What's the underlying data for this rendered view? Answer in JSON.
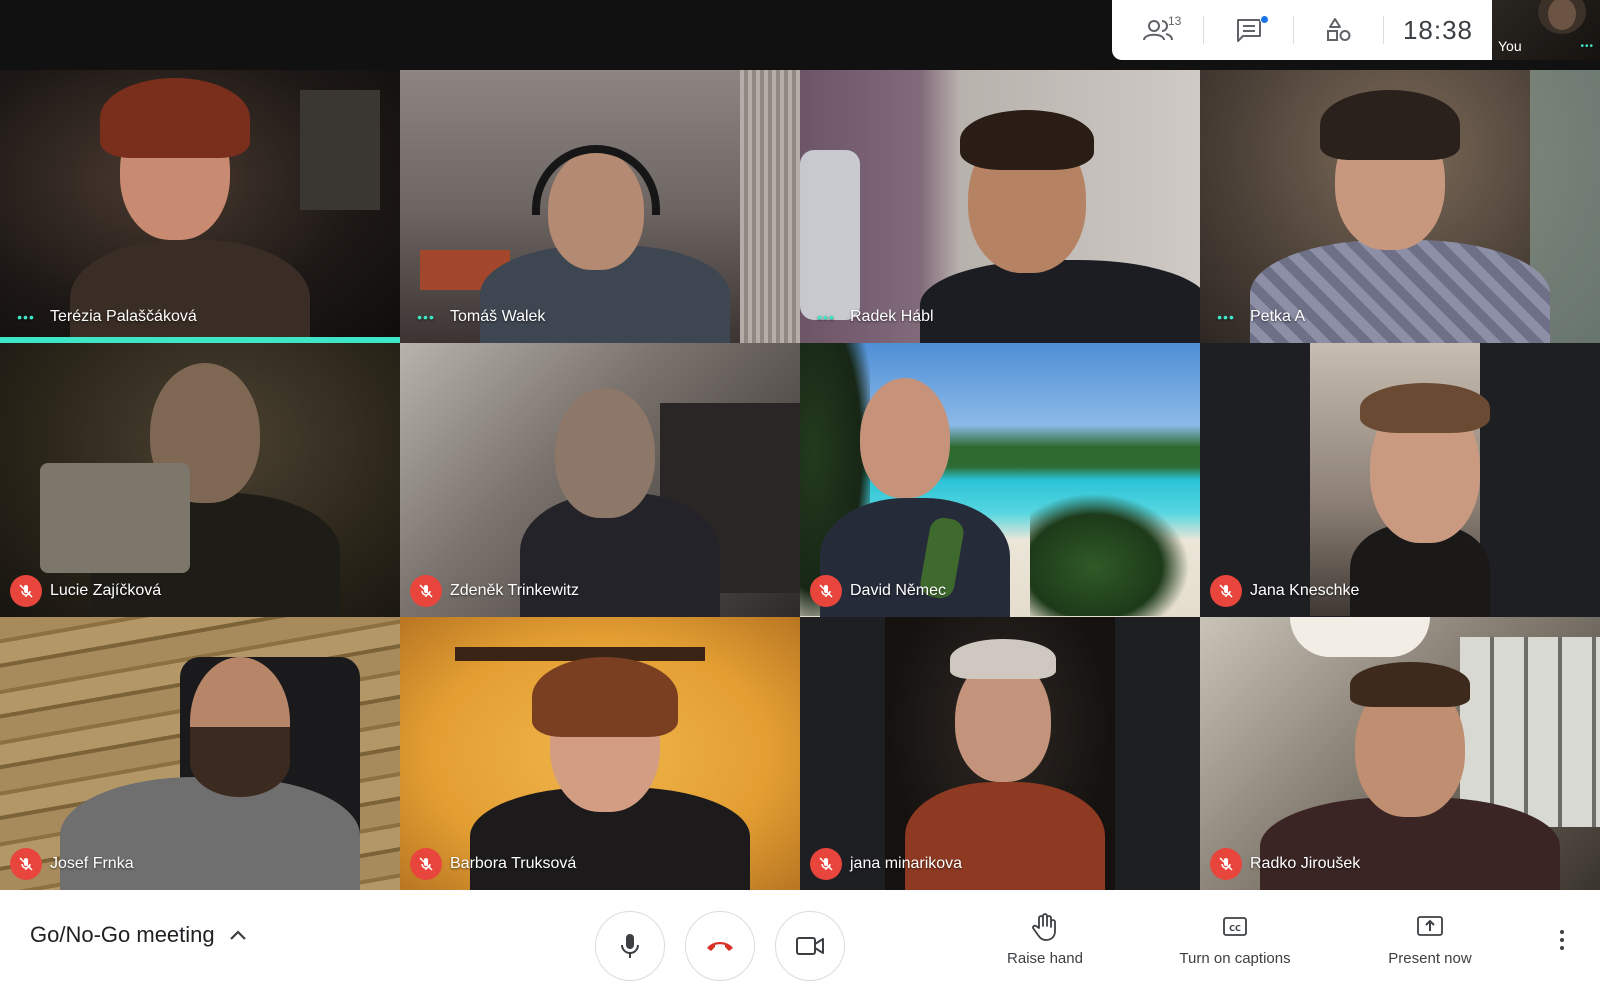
{
  "top_bar": {
    "people_count": "13",
    "clock": "18:38",
    "self_view_label": "You",
    "speaking_indicator": "•••",
    "icons": [
      "people-icon",
      "chat-icon",
      "activities-icon"
    ]
  },
  "participants": [
    {
      "name": "Terézia Palaščáková",
      "status": "speaking"
    },
    {
      "name": "Tomáš Walek",
      "status": "speaking"
    },
    {
      "name": "Radek Hábl",
      "status": "speaking"
    },
    {
      "name": "Petka A",
      "status": "speaking"
    },
    {
      "name": "Lucie Zajíčková",
      "status": "muted"
    },
    {
      "name": "Zdeněk Trinkewitz",
      "status": "muted"
    },
    {
      "name": "David Němec",
      "status": "muted"
    },
    {
      "name": "Jana Kneschke",
      "status": "muted"
    },
    {
      "name": "Josef Frnka",
      "status": "muted"
    },
    {
      "name": "Barbora Truksová",
      "status": "muted"
    },
    {
      "name": "jana minarikova",
      "status": "muted"
    },
    {
      "name": "Radko Jiroušek",
      "status": "muted"
    }
  ],
  "bottom_bar": {
    "meeting_title": "Go/No-Go meeting",
    "raise_hand": "Raise hand",
    "captions": "Turn on captions",
    "present": "Present now"
  },
  "colors": {
    "active_speaker": "#3ee6c8",
    "muted": "#e8453c",
    "hangup": "#d93025"
  }
}
